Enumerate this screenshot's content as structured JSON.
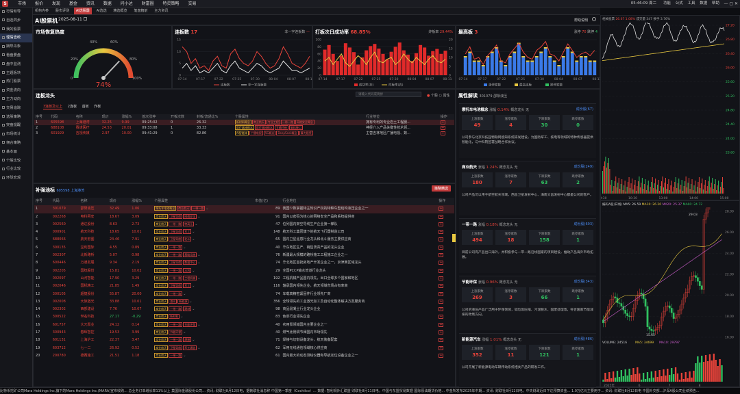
{
  "topbar": {
    "logo": "S",
    "menu": [
      "市场",
      "报价",
      "发现",
      "基金",
      "资讯",
      "数据",
      "问小达",
      "财富圈",
      "特灵策略",
      "交易"
    ],
    "right_items": [
      "05:46:09 周二",
      "功能",
      "公式",
      "工具",
      "数据",
      "帮助"
    ]
  },
  "subbar": {
    "items": [
      "机构内参",
      "股市评测",
      "AI选股器",
      "AI选选",
      "精选概览",
      "笔盘箱前",
      "主力资讯"
    ],
    "active_index": 2
  },
  "leftnav": {
    "items": [
      "行情积导",
      "自选同步",
      "我的股票",
      "理情查统",
      "期导舟象",
      "看盘要盘",
      "盘中监测",
      "主题板块",
      "热门股票",
      "资金流向",
      "主力动向",
      "交易追踪",
      "选股策略",
      "突盘提醒",
      "市场统计",
      "佣合策略",
      "基本面",
      "个股比较",
      "行业比较",
      "环球宏观"
    ],
    "active_index": 3
  },
  "header": {
    "title": "AI股票机",
    "date": "2025-08-11",
    "help_link": "帮助说明"
  },
  "sentiment": {
    "title": "市场恢复热度",
    "value": "74%",
    "ticks": [
      "0",
      "20%",
      "40%",
      "60%",
      "80%",
      "100%"
    ],
    "value_pct": 74
  },
  "limit_up": {
    "title": "连板数",
    "count": "17",
    "legend": "非一字连板数",
    "legend2": "一字连板数",
    "series_label1": "连板数",
    "series_label2": "非一字连板数",
    "xticks": [
      "07-14",
      "07-17",
      "07-22",
      "07-25",
      "07-30",
      "08-04",
      "08-07",
      "08-11"
    ],
    "ymax": "15",
    "ymid": "10",
    "ylow": "5",
    "yzero": "0"
  },
  "next_day": {
    "title": "打板次日成功率",
    "rate": "68.85%",
    "right_label": "炸板率",
    "right_value": "29.44%",
    "legend1": "成功率(左)",
    "legend2": "炸板率(右)",
    "xticks": [
      "07-14",
      "07-17",
      "07-22",
      "07-25",
      "07-30",
      "08-04",
      "08-07",
      "08-11"
    ],
    "yl": [
      "100",
      "80",
      "60",
      "40",
      "20",
      "0"
    ],
    "yr": [
      "20",
      "15",
      "10",
      "5",
      "0"
    ]
  },
  "max_board": {
    "title": "最高板",
    "value": "3",
    "right_label": "涨停",
    "right_value": "70",
    "right_label2": "跌停",
    "right_value2": "4",
    "legend1": "涨停家数",
    "legend2": "最高连板",
    "legend3": "跌停家数",
    "xticks": [
      "07-14",
      "07-17",
      "07-22",
      "07-25",
      "07-30",
      "08-04",
      "08-07",
      "08-11"
    ]
  },
  "leaders": {
    "title": "连板龙头",
    "search_placeholder": "请输入代码或简拼",
    "tabs": [
      "3连板及以上",
      "2连板",
      "首板",
      "炸板"
    ],
    "radio1": "个股",
    "radio2": "属性",
    "columns": [
      "序号",
      "代码",
      "名称",
      "现价",
      "涨幅%",
      "首次涨停",
      "开板次数",
      "封板/流通比%",
      "个股属性",
      "行业地位",
      "操作"
    ],
    "rows": [
      {
        "no": "1",
        "code": "605598",
        "name": "上海港湾",
        "price": "32.25",
        "chg": "9.99",
        "first": "09:25:02",
        "open": "0",
        "ratio": "26.32",
        "tags": [
          "新材料概念",
          "商业航天",
          "专业工程",
          "一带一路",
          "网络安全概念"
        ],
        "pos": "拥有专利的专业岩土工程服..."
      },
      {
        "no": "2",
        "code": "688108",
        "name": "赛诺医疗",
        "price": "24.53",
        "chg": "20.01",
        "first": "09:33:08",
        "open": "1",
        "ratio": "33.33",
        "tags": [
          "医疗器械概念",
          "医疗器械概念",
          "专精特新",
          "脑机接口"
        ],
        "pos": "神经介入产品关键性技术领..."
      },
      {
        "no": "3",
        "code": "601929",
        "name": "吉视传媒",
        "price": "2.97",
        "chg": "10.00",
        "first": "09:41:29",
        "open": "0",
        "ratio": "82.86",
        "tags": [
          "AI智能体",
          "广播电视",
          "5G概念",
          "DeepSeek概念",
          "算力租赁"
        ],
        "pos": "主营吉林地区广播电视、数..."
      }
    ]
  },
  "attr": {
    "title": "属性解读",
    "code": "301079",
    "name": "邵阳液压",
    "cards": [
      {
        "name": "摩托车电池概念",
        "chg_label": "涨幅",
        "chg": "0.14%",
        "lead_label": "概念龙头",
        "lead": "无",
        "link": "成份股(67)",
        "stats": [
          [
            "上涨家数",
            "49",
            "red"
          ],
          [
            "涨停家数",
            "4",
            "red"
          ],
          [
            "下跌家数",
            "30",
            "green"
          ],
          [
            "跌停家数",
            "0",
            "green"
          ]
        ],
        "text": "公司参与北京科技园物联网感知系统研发建设，为国防军工、核电等领域的特种传感器提供智能化，与中科院签署战略合作协议。"
      },
      {
        "name": "商业航天",
        "chg_label": "涨幅",
        "chg": "1.24%",
        "lead_label": "概念龙头",
        "lead": "无",
        "link": "成份股(249)",
        "stats": [
          [
            "上涨家数",
            "180",
            "red"
          ],
          [
            "涨停家数",
            "7",
            "red"
          ],
          [
            "下跌家数",
            "63",
            "green"
          ],
          [
            "跌停家数",
            "2",
            "green"
          ]
        ],
        "text": "公司产品可以用于航空航天领域，西昌卫星发射中心、海南文昌发射中心都是公司的客户。"
      },
      {
        "name": "一带一路",
        "chg_label": "涨幅",
        "chg": "0.18%",
        "lead_label": "概念龙头",
        "lead": "无",
        "link": "成份股(693)",
        "stats": [
          [
            "上涨家数",
            "494",
            "red"
          ],
          [
            "涨停家数",
            "18",
            "red"
          ],
          [
            "下跌家数",
            "158",
            "green"
          ],
          [
            "跌停家数",
            "1",
            "green"
          ]
        ],
        "text": "目前公司有产品出口海外，并积极参与一带一路沿线国家的项目建设，推动产品海外市场拓展。"
      },
      {
        "name": "节能环保",
        "chg_label": "涨幅",
        "chg": "0.96%",
        "lead_label": "概念龙头",
        "lead": "无",
        "link": "成份股(343)",
        "stats": [
          [
            "上涨家数",
            "269",
            "red"
          ],
          [
            "涨停家数",
            "3",
            "red"
          ],
          [
            "下跌家数",
            "66",
            "green"
          ],
          [
            "跌停家数",
            "1",
            "green"
          ]
        ],
        "text": "公司的液压产品广泛用于环保领域，如垃圾压缩、污泥脱水、固废处理等，符合国家节能减排的政策方向。"
      },
      {
        "name": "新能源汽车",
        "chg_label": "涨幅",
        "chg": "1.01%",
        "lead_label": "概念龙头",
        "lead": "无",
        "link": "成份股(486)",
        "stats": [
          [
            "上涨家数",
            "352",
            "red"
          ],
          [
            "涨停家数",
            "11",
            "red"
          ],
          [
            "下跌家数",
            "121",
            "green"
          ],
          [
            "跌停家数",
            "1",
            "green"
          ]
        ],
        "text": "公司开展了新能源电动车辆传动系统相关产品的研发工作。"
      }
    ]
  },
  "limit_pool": {
    "title": "补强池标",
    "sub": "605598 上海港湾",
    "button": "策略精选",
    "columns": [
      "序号",
      "代码",
      "名称",
      "现价",
      "涨幅%",
      "个股属性",
      "市值(亿)",
      "行业地位",
      "操作"
    ],
    "rows": [
      {
        "no": "1",
        "code": "301079",
        "name": "邵阳液压",
        "price": "32.49",
        "chg": "1.06",
        "tags": [
          "摩托车电池概念",
          "商业航天",
          "一带一路"
        ],
        "cap": "89",
        "pos": "我国少数掌握特主知识产权的特种车型结构液压企业之一"
      },
      {
        "no": "2",
        "code": "002268",
        "name": "电科网安",
        "price": "18.67",
        "chg": "3.09",
        "tags": [
          "商业航天",
          "卫星导航",
          "网络安全"
        ],
        "cap": "91",
        "pos": "国内以密码为核心的网络安全产品和系统提供商"
      },
      {
        "no": "3",
        "code": "002560",
        "name": "通达股份",
        "price": "8.63",
        "chg": "2.73",
        "tags": [
          "商业航天",
          "一带一路",
          "特高压"
        ],
        "cap": "47",
        "pos": "位列国内架空导线生产企业第一梯队"
      },
      {
        "no": "4",
        "code": "000901",
        "name": "航天科技",
        "price": "18.65",
        "chg": "10.01",
        "tags": [
          "商业航天",
          "卫星导航",
          "军工"
        ],
        "cap": "148",
        "pos": "航天科工集团旗下的航天飞行器制造公司"
      },
      {
        "no": "5",
        "code": "688066",
        "name": "航天宏图",
        "price": "24.46",
        "chg": "7.91",
        "tags": [
          "商业航天",
          "卫星导航",
          "北斗"
        ],
        "cap": "65",
        "pos": "国内卫星遥感行业龙头和北斗服务主要供应商"
      },
      {
        "no": "6",
        "code": "300135",
        "name": "宝利国际",
        "price": "4.55",
        "chg": "0.89",
        "tags": [
          "商业航天",
          "一带一路"
        ],
        "cap": "40",
        "pos": "华东地区生产、销售沥青产品的龙头企业"
      },
      {
        "no": "7",
        "code": "002307",
        "name": "北新路桥",
        "price": "5.07",
        "chg": "0.98",
        "tags": [
          "商业航天",
          "一带一路",
          "基础设施"
        ],
        "cap": "76",
        "pos": "新疆最大规模的路桥施工工程施工企业之一"
      },
      {
        "no": "8",
        "code": "600446",
        "name": "万通发展",
        "price": "9.34",
        "chg": "2.19",
        "tags": [
          "商业航天",
          "卫星导航",
          "数据中心"
        ],
        "cap": "74",
        "pos": "华北地区首批房地产开发企业之一，京津冀区域龙头"
      },
      {
        "no": "9",
        "code": "002205",
        "name": "国统股份",
        "price": "15.81",
        "chg": "10.02",
        "tags": [
          "商业航天",
          "一带一路",
          "水利"
        ],
        "cap": "29",
        "pos": "全国PCCP输水管道行业龙头"
      },
      {
        "no": "10",
        "code": "002097",
        "name": "山河智能",
        "price": "17.90",
        "chg": "3.29",
        "tags": [
          "商业航天",
          "一带一路",
          "工程机械"
        ],
        "cap": "192",
        "pos": "工程机械产品国内领先，出口全球多个国家和地区"
      },
      {
        "no": "11",
        "code": "002046",
        "name": "国机精工",
        "price": "21.85",
        "chg": "1.49",
        "tags": [
          "商业航天",
          "卫星导航",
          "军工"
        ],
        "cap": "116",
        "pos": "轴承国内领先企业，航天领域市场占有率高"
      },
      {
        "no": "12",
        "code": "300105",
        "name": "超捷股份",
        "price": "55.87",
        "chg": "20.00",
        "tags": [
          "商业航天",
          "一带一路"
        ],
        "cap": "74",
        "pos": "车载高精密紧固件行业领先厂商"
      },
      {
        "no": "13",
        "code": "002008",
        "name": "大族激光",
        "price": "33.88",
        "chg": "10.01",
        "tags": [
          "商业航天",
          "激光",
          "新能源"
        ],
        "cap": "356",
        "pos": "全球领先的工业激光加工及自动化整体解决方案服务商"
      },
      {
        "no": "14",
        "code": "002302",
        "name": "西部建设",
        "price": "7.76",
        "chg": "10.07",
        "tags": [
          "商业航天",
          "一带一路",
          "建材"
        ],
        "cap": "98",
        "pos": "商品混凝土行业龙头企业"
      },
      {
        "no": "15",
        "code": "300522",
        "name": "世名科技",
        "price": "27.17",
        "chg": "-0.29",
        "tags": [
          "商业航天",
          "新材料"
        ],
        "cap": "83",
        "pos": "色浆行业领先企业"
      },
      {
        "no": "16",
        "code": "601757",
        "name": "大元泵业",
        "price": "24.12",
        "chg": "0.14",
        "tags": [
          "商业航天",
          "一带一路",
          "节能环保"
        ],
        "cap": "40",
        "pos": "农用泵领域国内主要企业之一"
      },
      {
        "no": "17",
        "code": "300943",
        "name": "春晖智控",
        "price": "19.53",
        "chg": "3.99",
        "tags": [
          "商业航天",
          "节能环保"
        ],
        "cap": "40",
        "pos": "燃气比例调节阀国内市场领先"
      },
      {
        "no": "18",
        "code": "601131",
        "name": "上海沪工",
        "price": "22.37",
        "chg": "3.47",
        "tags": [
          "商业航天",
          "一带一路",
          "焊接"
        ],
        "cap": "71",
        "pos": "焊接与切割设备龙头，航天装备配套"
      },
      {
        "no": "19",
        "code": "603712",
        "name": "七一二",
        "price": "26.92",
        "chg": "0.52",
        "tags": [
          "商业航天",
          "卫星导航",
          "军工通信"
        ],
        "cap": "62",
        "pos": "军用无线通信领域核心供应商"
      },
      {
        "no": "20",
        "code": "200780",
        "name": "德赛施工",
        "price": "21.51",
        "chg": "1.18",
        "tags": [
          "商业航天",
          "一带一路"
        ],
        "cap": "61",
        "pos": "国内最大的动态测绘仪器和导航定位设备企业之一"
      }
    ]
  },
  "kline": {
    "title": "相关股票",
    "price_label": "最新价",
    "price": "26.67",
    "chg": "1.08%",
    "right_info": "成交量 347",
    "turnover": "换手 3.76%",
    "pe": "量比 6.12",
    "y_ticks": [
      "27.20",
      "26.80",
      "26.40",
      "26.00",
      "25.60",
      "25.20",
      "24.80",
      "24.40",
      "24.00",
      "23.60"
    ],
    "x_ticks": [
      "09:30",
      "10:30",
      "13:00",
      "14:00",
      "15:00"
    ]
  },
  "daily": {
    "title": "编码A股(日线)",
    "ma5": "MA5: 26.59",
    "ma10": "MA10: 26.20",
    "ma20": "MA20: 25.37",
    "ma60": "MA60: 24.72",
    "high": "29.03",
    "low": "15.65",
    "y_ticks": [
      "28.00",
      "26.00",
      "24.00",
      "22.00",
      "20.00",
      "18.00",
      "16.00"
    ],
    "vol_label": "VOLUME: 24516",
    "vma5": "MA5: 34699",
    "vma10": "MA10: 29797",
    "x_ticks": [
      "2025年",
      "6",
      "7",
      "8"
    ]
  },
  "ticker": {
    "text": "比特币挖矿公司Mara Holdings Inc.旗下的Mara Holdings Inc.(MARA)宣布收购... 总业务订单增长率11%以上 莫国际金融股份公司... 资讯: 财联社8月12日电，据韩联社消息称 中国第一季度（Cochilco）... 数据: 智利铜外汇联盟 财联社8月11日电，中国与东盟贸易数据 国际原油期货价格... 中金所发布2025年中期... 资讯: 财联社8月12日电，中央财政近日下达预算资金... 1.0万亿元主要用于... 资讯: 财联社8月12日电 中国外交部...沪深A股公司业绩预告..."
  }
}
